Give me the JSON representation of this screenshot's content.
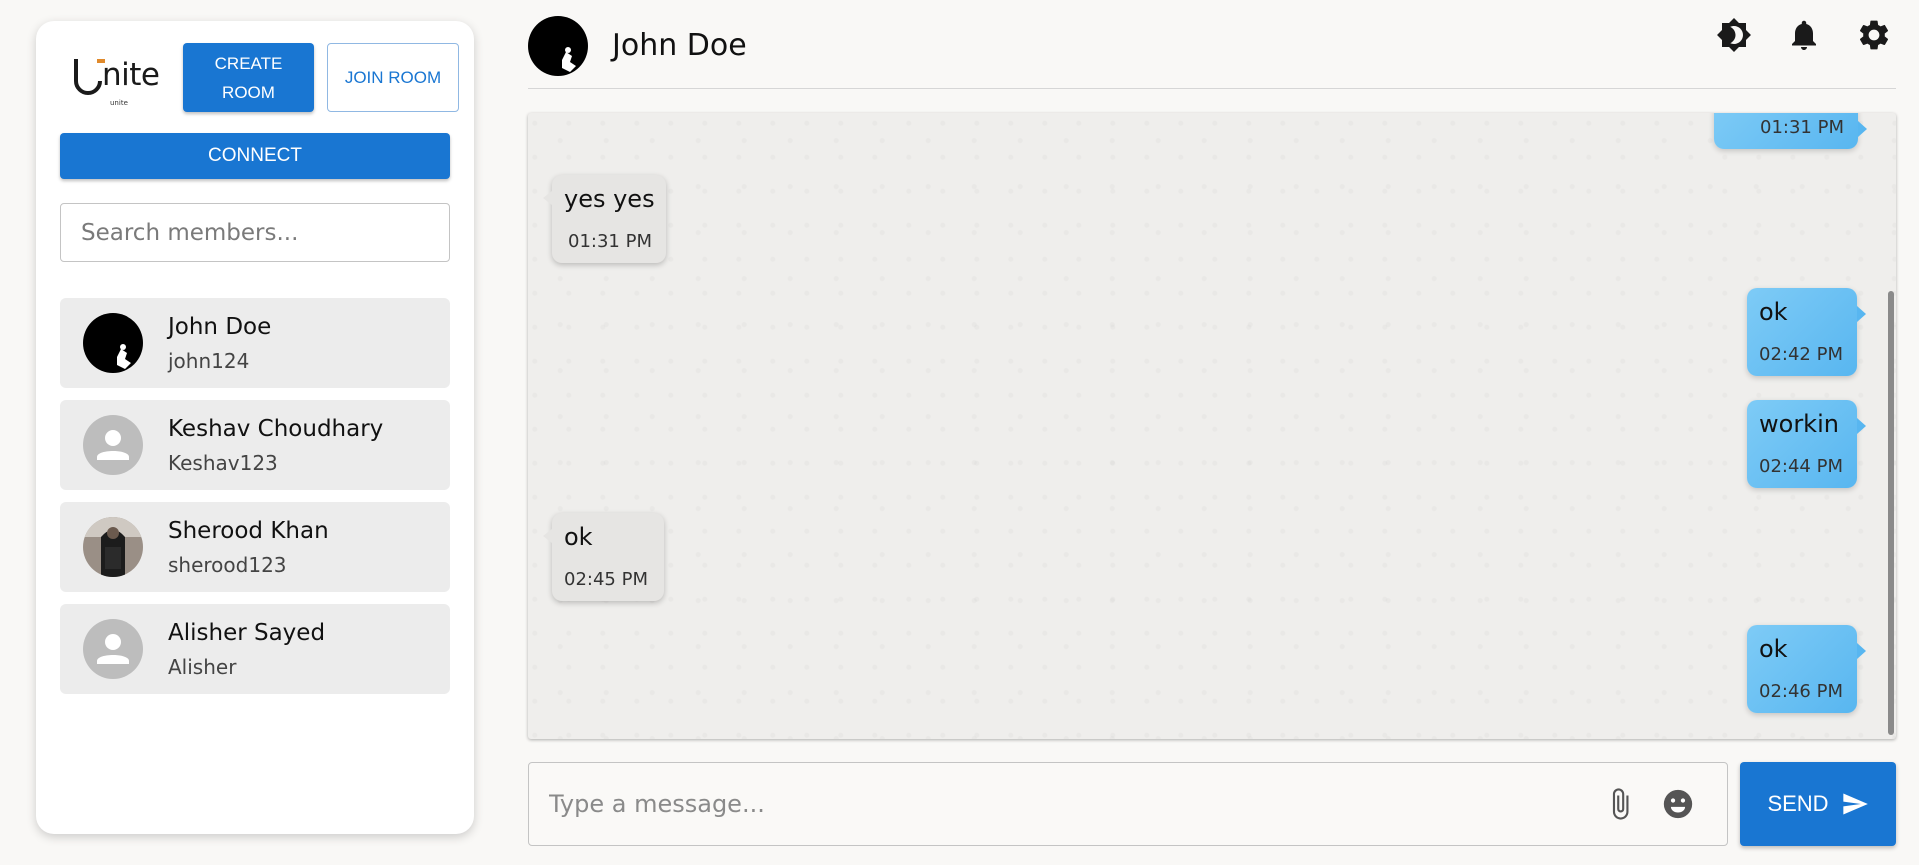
{
  "sidebar": {
    "logo_text": "Unite",
    "logo_sub": "unite",
    "create_room_label": "CREATE ROOM",
    "join_room_label": "JOIN ROOM",
    "connect_label": "CONNECT",
    "search_placeholder": "Search members...",
    "members": [
      {
        "name": "John Doe",
        "username": "john124",
        "avatar": "photo-avatar"
      },
      {
        "name": "Keshav Choudhary",
        "username": "Keshav123",
        "avatar": "default-person-icon"
      },
      {
        "name": "Sherood Khan",
        "username": "sherood123",
        "avatar": "photo-avatar"
      },
      {
        "name": "Alisher Sayed",
        "username": "Alisher",
        "avatar": "default-person-icon"
      }
    ]
  },
  "header": {
    "contact_name": "John Doe",
    "icons": [
      "theme-toggle-icon",
      "bell-icon",
      "gear-icon"
    ]
  },
  "messages": [
    {
      "direction": "out",
      "text": "",
      "time": "01:31 PM"
    },
    {
      "direction": "in",
      "text": "yes yes",
      "time": "01:31 PM"
    },
    {
      "direction": "out",
      "text": "ok",
      "time": "02:42 PM"
    },
    {
      "direction": "out",
      "text": "workin",
      "time": "02:44 PM"
    },
    {
      "direction": "in",
      "text": "ok",
      "time": "02:45 PM"
    },
    {
      "direction": "out",
      "text": "ok",
      "time": "02:46 PM"
    }
  ],
  "composer": {
    "placeholder": "Type a message...",
    "send_label": "SEND"
  },
  "colors": {
    "primary": "#1976d2",
    "outgoing_bubble": "#64bcf2",
    "incoming_bubble": "#e6e5e3"
  }
}
